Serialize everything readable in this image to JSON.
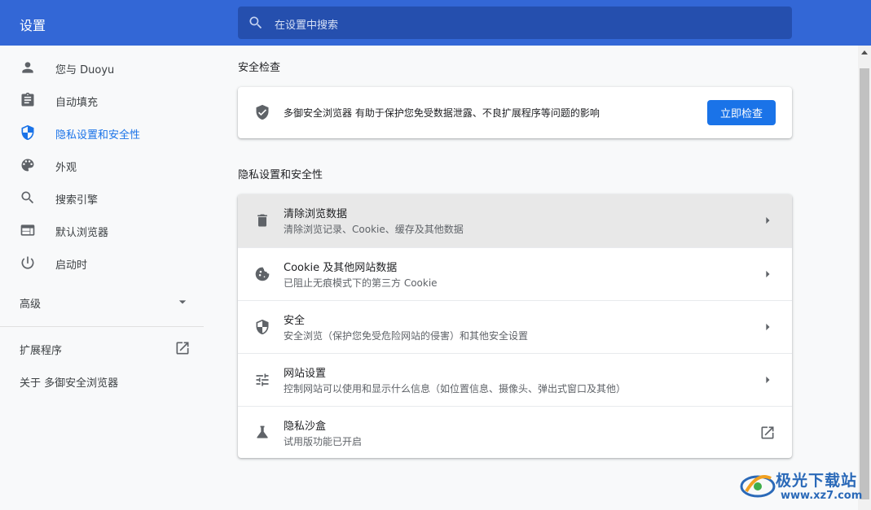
{
  "header": {
    "title": "设置",
    "search_placeholder": "在设置中搜索"
  },
  "sidebar": {
    "items": [
      {
        "label": "您与 Duoyu",
        "icon": "person-icon"
      },
      {
        "label": "自动填充",
        "icon": "clipboard-icon"
      },
      {
        "label": "隐私设置和安全性",
        "icon": "shield-icon",
        "active": true
      },
      {
        "label": "外观",
        "icon": "palette-icon"
      },
      {
        "label": "搜索引擎",
        "icon": "search-icon"
      },
      {
        "label": "默认浏览器",
        "icon": "browser-window-icon"
      },
      {
        "label": "启动时",
        "icon": "power-icon"
      }
    ],
    "advanced_label": "高级",
    "extensions_label": "扩展程序",
    "about_label": "关于 多御安全浏览器"
  },
  "safety_check": {
    "section_title": "安全检查",
    "description": "多御安全浏览器 有助于保护您免受数据泄露、不良扩展程序等问题的影响",
    "button_label": "立即检查"
  },
  "privacy": {
    "section_title": "隐私设置和安全性",
    "rows": [
      {
        "title": "清除浏览数据",
        "subtitle": "清除浏览记录、Cookie、缓存及其他数据",
        "icon": "trash-icon"
      },
      {
        "title": "Cookie 及其他网站数据",
        "subtitle": "已阻止无痕模式下的第三方 Cookie",
        "icon": "cookie-icon"
      },
      {
        "title": "安全",
        "subtitle": "安全浏览（保护您免受危险网站的侵害）和其他安全设置",
        "icon": "security-shield-icon"
      },
      {
        "title": "网站设置",
        "subtitle": "控制网站可以使用和显示什么信息（如位置信息、摄像头、弹出式窗口及其他）",
        "icon": "tune-icon"
      },
      {
        "title": "隐私沙盒",
        "subtitle": "试用版功能已开启",
        "icon": "flask-icon"
      }
    ]
  },
  "watermark": {
    "title": "极光下载站",
    "url": "www.xz7.com"
  },
  "colors": {
    "header_bg": "#3367d6",
    "accent": "#1a73e8"
  }
}
